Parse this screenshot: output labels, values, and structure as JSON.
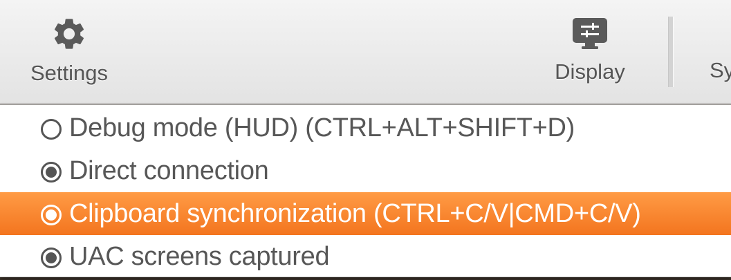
{
  "toolbar": {
    "settings": {
      "label": "Settings",
      "icon": "gear-icon"
    },
    "display": {
      "label": "Display",
      "icon": "display-settings-icon"
    },
    "next": {
      "label": "Sy"
    }
  },
  "menu": {
    "items": [
      {
        "label": "Debug mode (HUD) (CTRL+ALT+SHIFT+D)",
        "checked": false,
        "highlighted": false
      },
      {
        "label": "Direct connection",
        "checked": true,
        "highlighted": false
      },
      {
        "label": "Clipboard synchronization (CTRL+C/V|CMD+C/V)",
        "checked": true,
        "highlighted": true
      },
      {
        "label": "UAC screens captured",
        "checked": true,
        "highlighted": false
      }
    ]
  },
  "colors": {
    "highlight_top": "#ff9b45",
    "highlight_bottom": "#f3751f",
    "text": "#575757",
    "icon": "#5a5a5a"
  }
}
